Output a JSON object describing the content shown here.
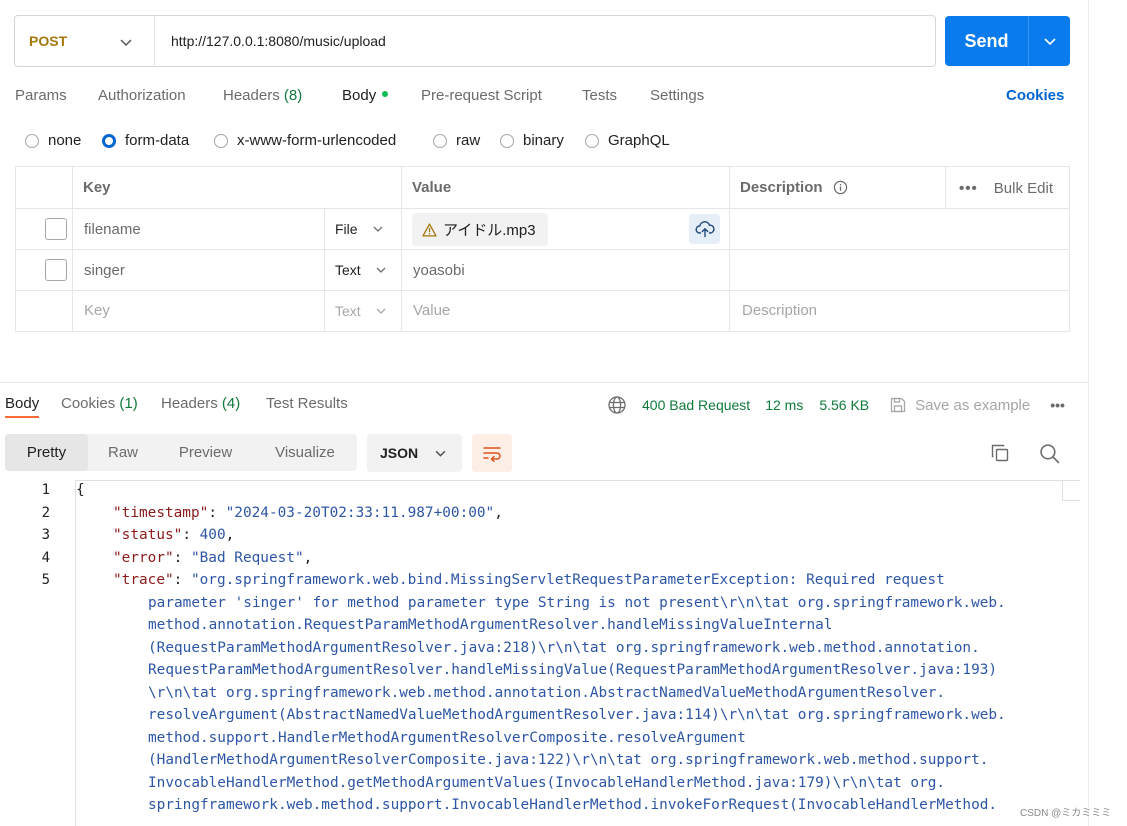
{
  "request": {
    "method": "POST",
    "url": "http://127.0.0.1:8080/music/upload",
    "send_label": "Send"
  },
  "request_tabs": {
    "params": "Params",
    "authorization": "Authorization",
    "headers": "Headers",
    "headers_count": "(8)",
    "body": "Body",
    "pre_request": "Pre-request Script",
    "tests": "Tests",
    "settings": "Settings",
    "cookies": "Cookies"
  },
  "body_types": {
    "none": "none",
    "form_data": "form-data",
    "urlencoded": "x-www-form-urlencoded",
    "raw": "raw",
    "binary": "binary",
    "graphql": "GraphQL",
    "selected": "form-data"
  },
  "form_table": {
    "headers": {
      "key": "Key",
      "value": "Value",
      "description": "Description",
      "bulk_edit": "Bulk Edit"
    },
    "rows": [
      {
        "key": "filename",
        "type": "File",
        "value": "アイドル.mp3"
      },
      {
        "key": "singer",
        "type": "Text",
        "value": "yoasobi"
      }
    ],
    "new_row": {
      "key": "Key",
      "type": "Text",
      "value": "Value",
      "description": "Description"
    }
  },
  "response_tabs": {
    "body": "Body",
    "cookies": "Cookies",
    "cookies_count": "(1)",
    "headers": "Headers",
    "headers_count": "(4)",
    "test_results": "Test Results"
  },
  "response_meta": {
    "status": "400 Bad Request",
    "time": "12 ms",
    "size": "5.56 KB",
    "save_example": "Save as example"
  },
  "view_modes": {
    "pretty": "Pretty",
    "raw": "Raw",
    "preview": "Preview",
    "visualize": "Visualize",
    "language": "JSON"
  },
  "code": {
    "line_numbers": [
      "1",
      "2",
      "3",
      "4",
      "5"
    ],
    "open_brace": "{",
    "timestamp_key": "\"timestamp\"",
    "timestamp_val": "\"2024-03-20T02:33:11.987+00:00\"",
    "status_key": "\"status\"",
    "status_val": "400",
    "error_key": "\"error\"",
    "error_val": "\"Bad Request\"",
    "trace_key": "\"trace\"",
    "trace_lines": [
      "\"org.springframework.web.bind.MissingServletRequestParameterException: Required request",
      "parameter 'singer' for method parameter type String is not present\\r\\n\\tat org.springframework.web.",
      "method.annotation.RequestParamMethodArgumentResolver.handleMissingValueInternal",
      "(RequestParamMethodArgumentResolver.java:218)\\r\\n\\tat org.springframework.web.method.annotation.",
      "RequestParamMethodArgumentResolver.handleMissingValue(RequestParamMethodArgumentResolver.java:193)",
      "\\r\\n\\tat org.springframework.web.method.annotation.AbstractNamedValueMethodArgumentResolver.",
      "resolveArgument(AbstractNamedValueMethodArgumentResolver.java:114)\\r\\n\\tat org.springframework.web.",
      "method.support.HandlerMethodArgumentResolverComposite.resolveArgument",
      "(HandlerMethodArgumentResolverComposite.java:122)\\r\\n\\tat org.springframework.web.method.support.",
      "InvocableHandlerMethod.getMethodArgumentValues(InvocableHandlerMethod.java:179)\\r\\n\\tat org.",
      "springframework.web.method.support.InvocableHandlerMethod.invokeForRequest(InvocableHandlerMethod."
    ]
  },
  "watermark": "CSDN @ミカミミミ",
  "colors": {
    "accent": "#097bed",
    "method": "#a4780c",
    "status_ok_green": "#0f7b3a",
    "json_key": "#8b1a1a",
    "json_value": "#2d56a6"
  }
}
